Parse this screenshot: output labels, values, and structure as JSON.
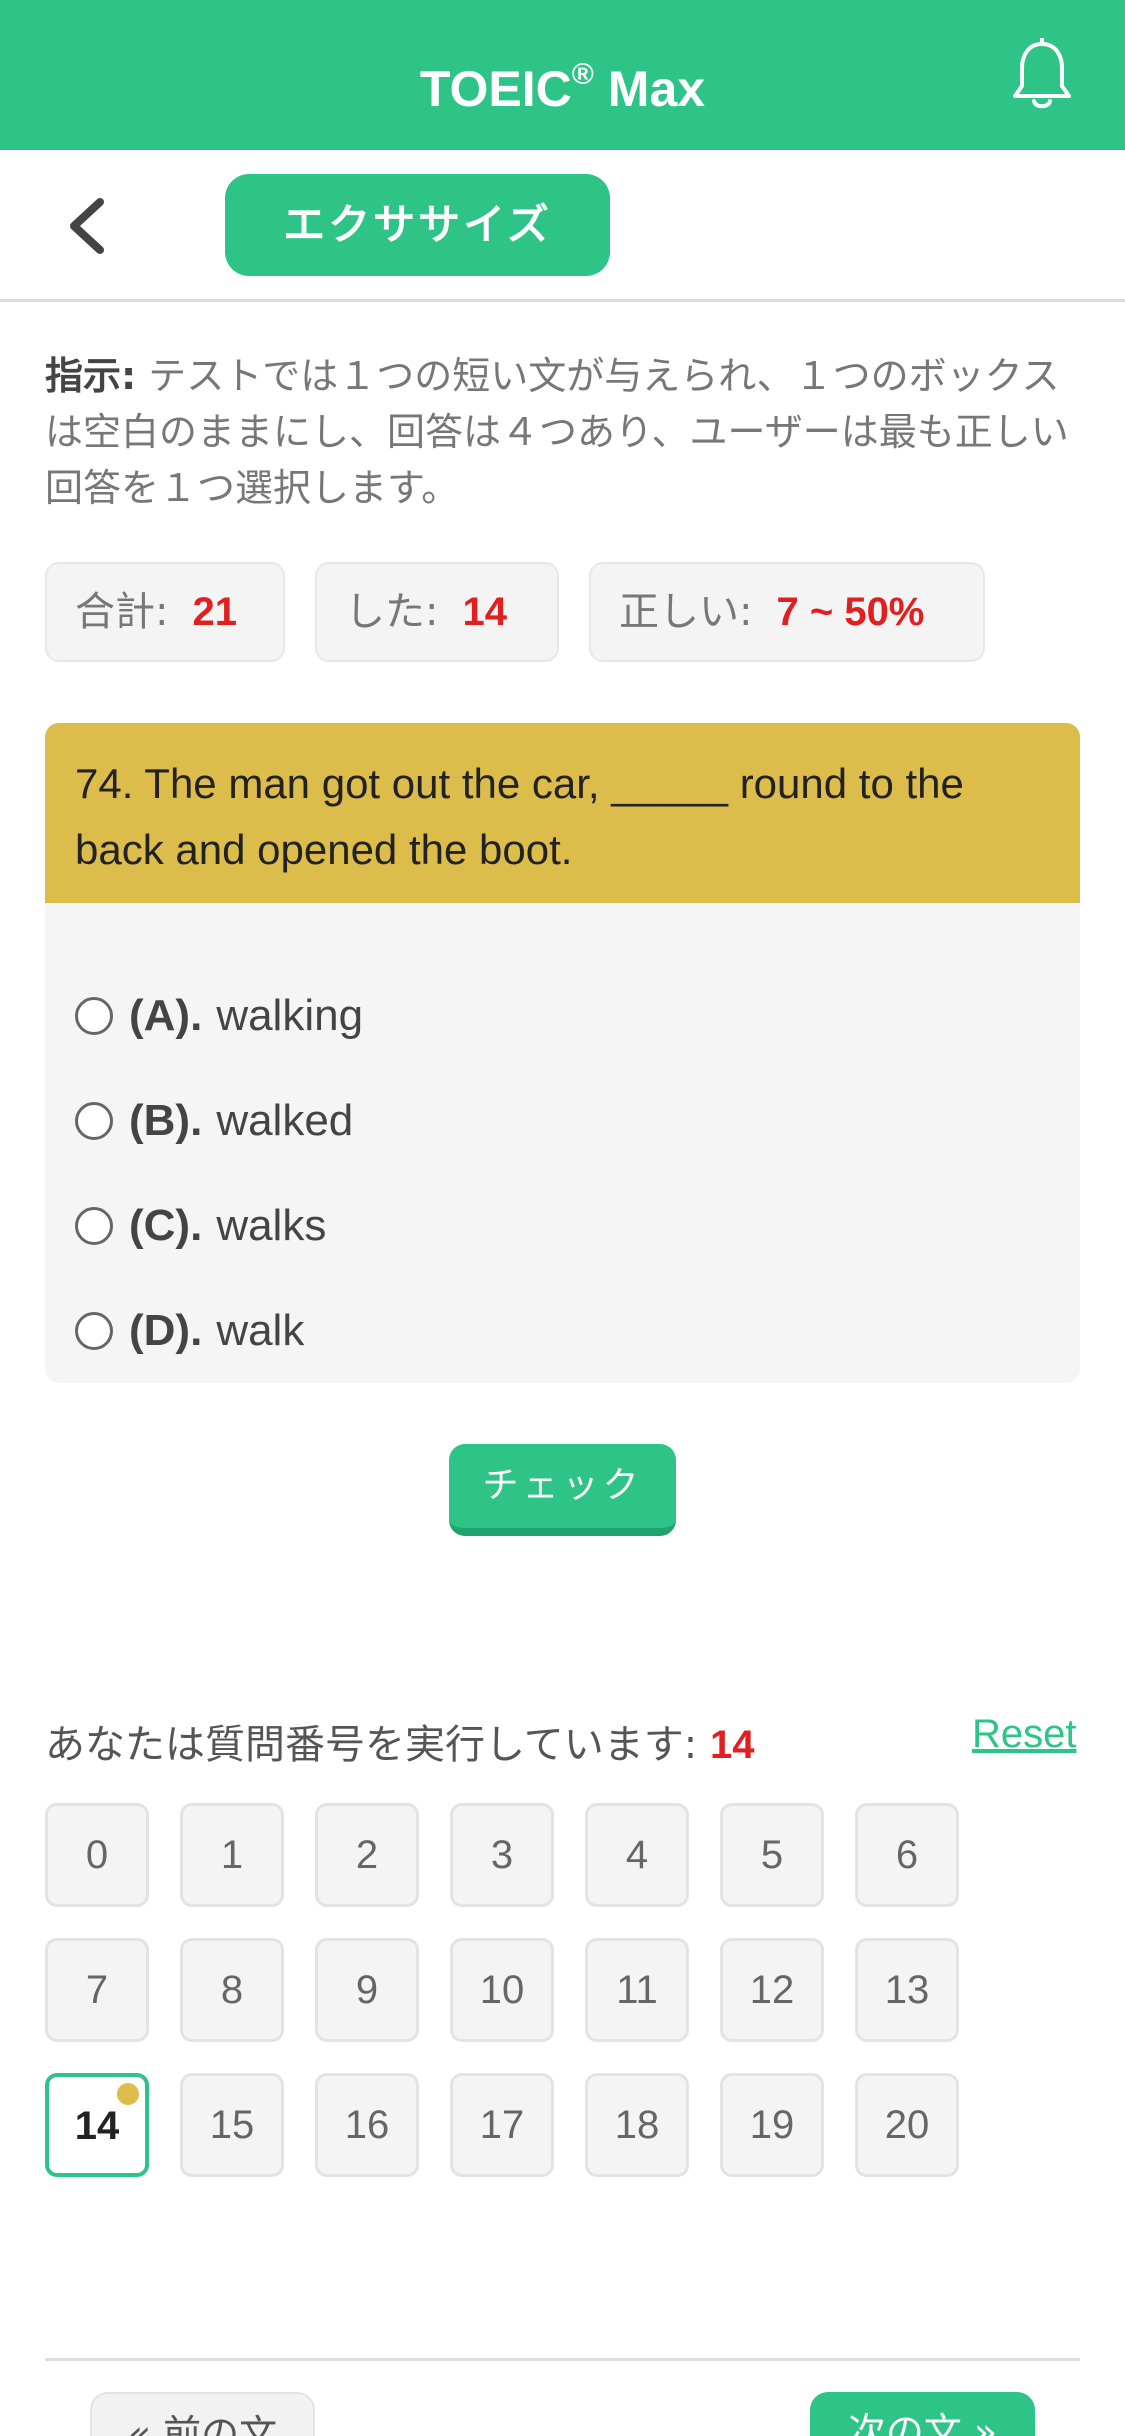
{
  "header": {
    "title": "TOEIC",
    "title_mark": "®",
    "title_suffix": " Max",
    "bell_icon": "bell-icon"
  },
  "subbar": {
    "back_icon": "chevron-left-icon",
    "tab_label": "エクササイズ"
  },
  "instructions": {
    "label": "指示:",
    "text": " テストでは１つの短い文が与えられ、１つのボックスは空白のままにし、回答は４つあり、ユーザーは最も正しい回答を１つ選択します。"
  },
  "stats": {
    "total_label": "合計:",
    "total_value": "21",
    "done_label": "した:",
    "done_value": "14",
    "correct_label": "正しい:",
    "correct_value": "7 ~ 50%"
  },
  "question": {
    "text": "74. The man got out the car, _____ round to the back and opened the boot.",
    "options": [
      {
        "key": "(A).",
        "text": "walking"
      },
      {
        "key": "(B).",
        "text": "walked"
      },
      {
        "key": "(C).",
        "text": "walks"
      },
      {
        "key": "(D).",
        "text": "walk"
      }
    ]
  },
  "check_label": "チェック",
  "progress": {
    "label": "あなたは質問番号を実行しています:",
    "current": "14",
    "reset_label": "Reset"
  },
  "grid": [
    "0",
    "1",
    "2",
    "3",
    "4",
    "5",
    "6",
    "7",
    "8",
    "9",
    "10",
    "11",
    "12",
    "13",
    "14",
    "15",
    "16",
    "17",
    "18",
    "19",
    "20"
  ],
  "nav": {
    "prev_label": "« 前の文",
    "next_label": "次の文 »"
  },
  "colors": {
    "brand": "#2ec487",
    "question_bg": "#dcbc4a",
    "highlight": "#e02020"
  }
}
